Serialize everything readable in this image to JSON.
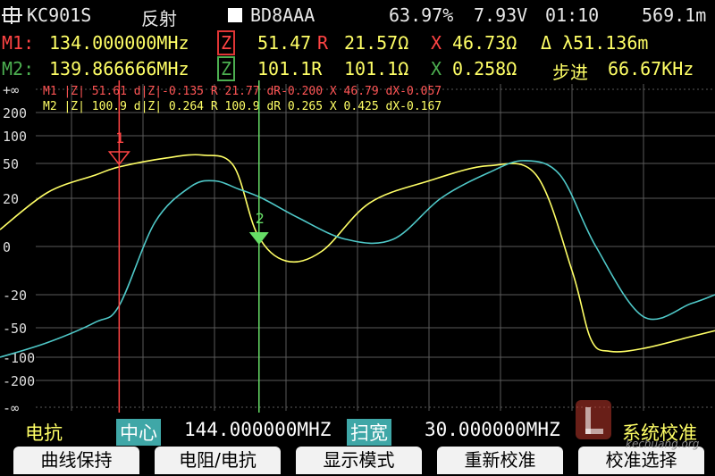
{
  "status": {
    "logo": "KC901S",
    "mode": "反射",
    "callsign": "BD8AAA",
    "battery": "63.97%",
    "voltage": "7.93V",
    "time": "01:10",
    "distance": "569.1m"
  },
  "markers": {
    "m1": {
      "label": "M1:",
      "freq": "134.000000MHz",
      "z_label": "Z",
      "r_value": "51.47",
      "r_letter": "R",
      "r_ohm": "21.57Ω",
      "x_letter": "X",
      "x_ohm": "46.73Ω",
      "extra": "Δ λ51.136m"
    },
    "m2": {
      "label": "M2:",
      "freq": "139.866666MHz",
      "z_label": "Z",
      "r_value": "101.1R",
      "r_ohm": "101.1Ω",
      "x_letter": "X",
      "x_ohm": "0.258Ω",
      "step_label": "步进",
      "step_value": "66.67KHz"
    }
  },
  "plot": {
    "overlay1": "M1 |Z| 51.61  d|Z|-0.135 R 21.77 dR-0.200 X 46.79  dX-0.057",
    "overlay2": "M2 |Z| 100.9  d|Z| 0.264 R 100.9 dR 0.265 X 0.425  dX-0.167",
    "y_labels": [
      "+∞",
      "200",
      "100",
      "50",
      "20",
      "0",
      "-20",
      "-50",
      "-100",
      "-200",
      "-∞"
    ],
    "marker1_tag": "1",
    "marker2_tag": "2"
  },
  "chart_data": {
    "type": "line",
    "title": "",
    "xlabel": "",
    "ylabel": "",
    "x_center_mhz": 144.0,
    "x_span_mhz": 30.0,
    "xlim": [
      129.0,
      159.0
    ],
    "y_scale": "nonlinear (±∞ compressed)",
    "ylim": [
      "-∞",
      "+∞"
    ],
    "y_ticks": [
      "+∞",
      "200",
      "100",
      "50",
      "20",
      "0",
      "-20",
      "-50",
      "-100",
      "-200",
      "-∞"
    ],
    "grid": true,
    "series": [
      {
        "name": "",
        "color": "#ffff66",
        "x": [
          129.0,
          131.0,
          133.0,
          134.0,
          136.0,
          137.5,
          138.8,
          139.8,
          141.0,
          142.5,
          144.5,
          147.0,
          149.5,
          151.5,
          153.0,
          153.8,
          154.6,
          156.0,
          158.0,
          159.0
        ],
        "y": [
          7,
          25,
          40,
          47,
          60,
          65,
          48,
          5,
          -6,
          -2,
          18,
          35,
          48,
          40,
          -10,
          -70,
          -90,
          -85,
          -65,
          -55
        ]
      },
      {
        "name": "",
        "color": "#4fc8c8",
        "x": [
          129.0,
          131.0,
          133.0,
          134.0,
          135.5,
          137.0,
          138.0,
          139.0,
          140.0,
          141.5,
          143.5,
          145.5,
          147.5,
          149.5,
          151.0,
          152.5,
          154.0,
          156.0,
          158.0,
          159.0
        ],
        "y": [
          -100,
          -75,
          -45,
          -30,
          10,
          30,
          35,
          28,
          20,
          12,
          3,
          3,
          20,
          42,
          55,
          40,
          0,
          -40,
          -28,
          -20
        ]
      }
    ],
    "markers": [
      {
        "name": "1",
        "x": 134.0
      },
      {
        "name": "2",
        "x": 139.866666
      }
    ]
  },
  "bottom": {
    "trace_mode": "电抗",
    "center_label": "中心",
    "center_value": "144.000000MHZ",
    "span_label": "扫宽",
    "span_value": "30.000000MHZ",
    "right_text": "系统校准"
  },
  "softkeys": [
    "曲线保持",
    "电阻/电抗",
    "显示模式",
    "重新校准",
    "校准选择"
  ],
  "watermark": "kechuang.org"
}
